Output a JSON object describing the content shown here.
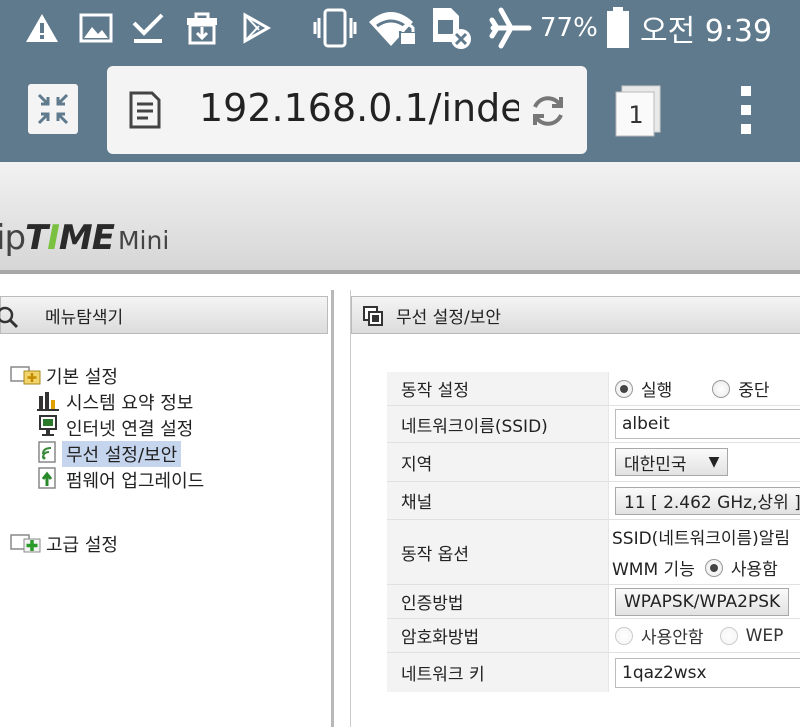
{
  "status_bar": {
    "icons": [
      "warning-icon",
      "image-icon",
      "download-done-icon",
      "store-icon",
      "play-store-icon",
      "vibrate-icon",
      "wifi-lock-icon",
      "sim-off-icon",
      "airplane-icon",
      "battery-icon"
    ],
    "battery": "77%",
    "time": "오전 9:39"
  },
  "browser": {
    "url": "192.168.0.1/inde",
    "tab_count": "1"
  },
  "router": {
    "logo_ip": "ip",
    "logo_t": "T",
    "logo_i": "I",
    "logo_me": "ME",
    "logo_mini": "Mini",
    "menu_title": "메뉴탐색기",
    "tree": {
      "basic": "기본 설정",
      "items": [
        "시스템 요약 정보",
        "인터넷 연결 설정",
        "무선 설정/보안",
        "펌웨어 업그레이드"
      ],
      "advanced": "고급 설정"
    },
    "content_title": "무선 설정/보안",
    "form": {
      "op_label": "동작 설정",
      "op_run": "실행",
      "op_stop": "중단",
      "ssid_label": "네트워크이름(SSID)",
      "ssid_value": "albeit",
      "region_label": "지역",
      "region_value": "대한민국",
      "channel_label": "채널",
      "channel_value": "11 [ 2.462 GHz,상위 ]",
      "options_label": "동작 옵션",
      "options_line1": "SSID(네트워크이름)알림",
      "options_wmm": "WMM 기능",
      "options_use": "사용함",
      "auth_label": "인증방법",
      "auth_value": "WPAPSK/WPA2PSK",
      "enc_label": "암호화방법",
      "enc_none": "사용안함",
      "enc_wep": "WEP",
      "key_label": "네트워크 키",
      "key_value": "1qaz2wsx"
    }
  },
  "colors": {
    "status_bg": "#5f7a8c",
    "selected_bg": "#c5d5ee",
    "logo_green": "#7ac142"
  }
}
